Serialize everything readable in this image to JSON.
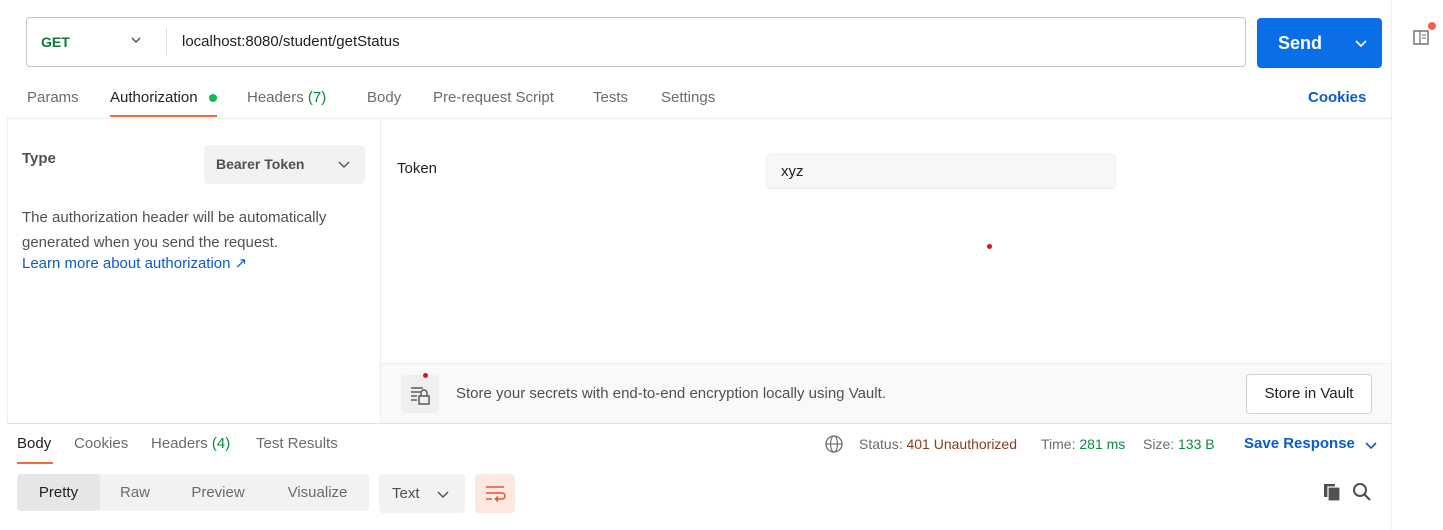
{
  "request": {
    "method": "GET",
    "url": "localhost:8080/student/getStatus",
    "send_label": "Send"
  },
  "request_tabs": [
    {
      "label": "Params"
    },
    {
      "label": "Authorization"
    },
    {
      "label": "Headers",
      "count": "(7)"
    },
    {
      "label": "Body"
    },
    {
      "label": "Pre-request Script"
    },
    {
      "label": "Tests"
    },
    {
      "label": "Settings"
    }
  ],
  "cookies_label": "Cookies",
  "auth": {
    "type_label": "Type",
    "type_value": "Bearer Token",
    "description": "The authorization header will be automatically generated when you send the request.",
    "learn_more": "Learn more about authorization ↗",
    "token_label": "Token",
    "token_value": "xyz"
  },
  "vault": {
    "message": "Store your secrets with end-to-end encryption locally using Vault.",
    "button_label": "Store in Vault"
  },
  "response_tabs": [
    {
      "label": "Body"
    },
    {
      "label": "Cookies"
    },
    {
      "label": "Headers",
      "count": "(4)"
    },
    {
      "label": "Test Results"
    }
  ],
  "response_status": {
    "status_label": "Status:",
    "status_value": "401 Unauthorized",
    "time_label": "Time:",
    "time_value": "281 ms",
    "size_label": "Size:",
    "size_value": "133 B",
    "save_label": "Save Response"
  },
  "view_modes": [
    "Pretty",
    "Raw",
    "Preview",
    "Visualize"
  ],
  "format": "Text",
  "colors": {
    "accent": "#0a6fe6",
    "tab_underline": "#f26b3a",
    "link": "#0a5cc7",
    "success": "#0b8a3e",
    "error": "#8a3b1a"
  },
  "icons": [
    "chevron-down-icon",
    "side-panel-icon",
    "globe-icon",
    "wrap-lines-icon",
    "copy-icon",
    "search-icon",
    "vault-icon"
  ]
}
